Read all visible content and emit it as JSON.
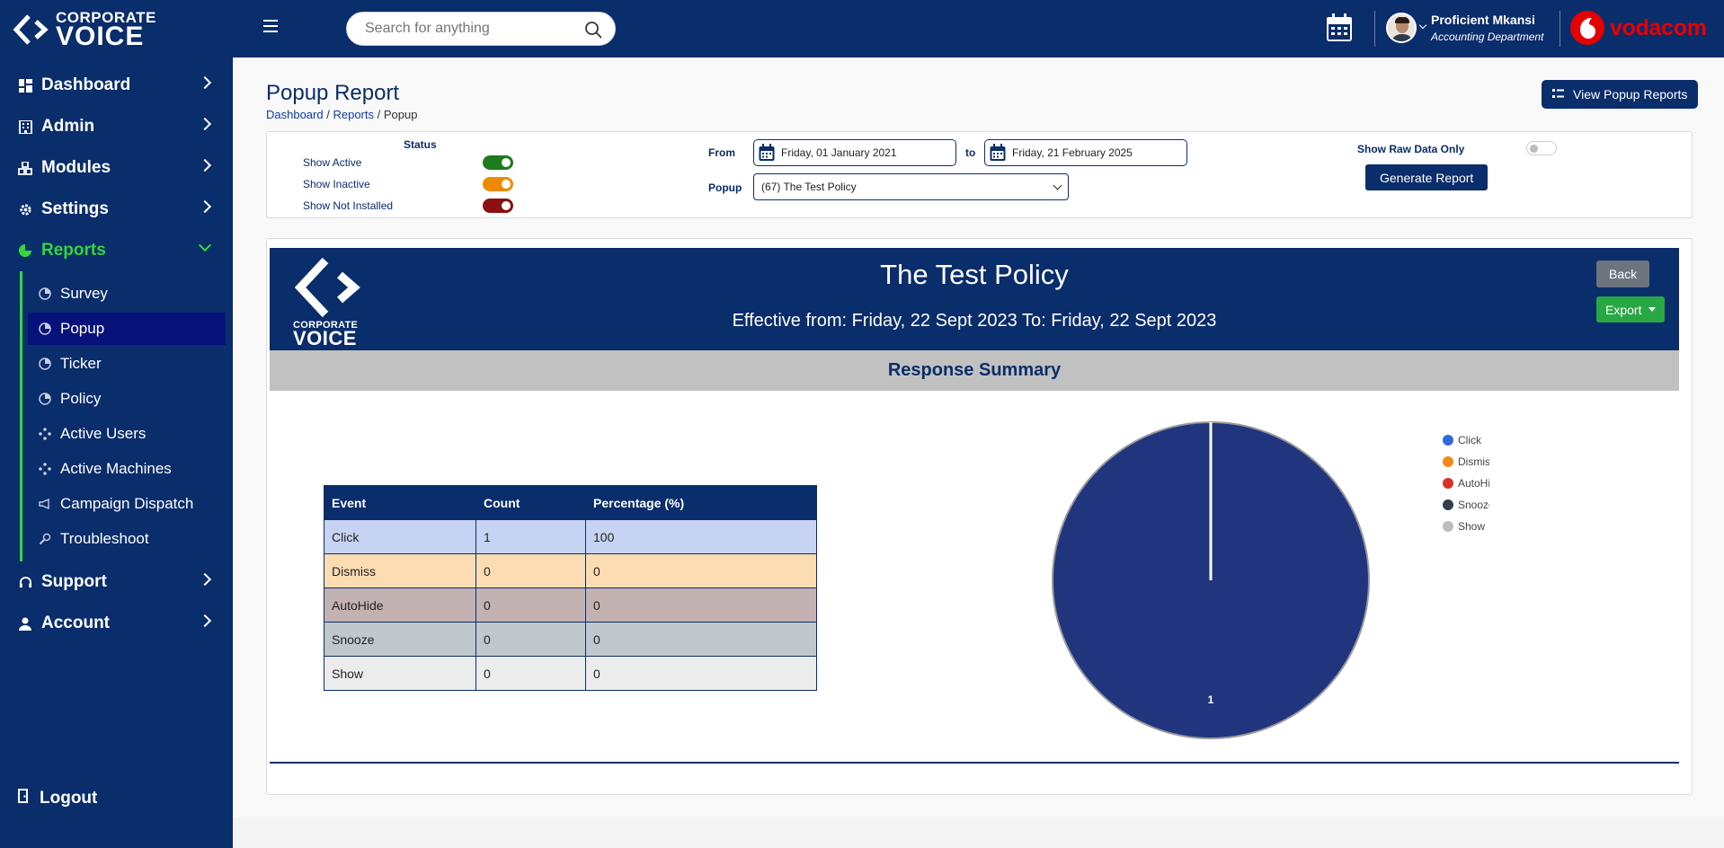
{
  "app": {
    "logo_line1": "CORPORATE",
    "logo_line2": "VOICE"
  },
  "sidebar": {
    "items": [
      {
        "label": "Dashboard",
        "icon": "grid-icon"
      },
      {
        "label": "Admin",
        "icon": "building-icon"
      },
      {
        "label": "Modules",
        "icon": "cubes-icon"
      },
      {
        "label": "Settings",
        "icon": "gear-icon"
      },
      {
        "label": "Reports",
        "icon": "pie-chart-icon"
      }
    ],
    "reports_sub": [
      {
        "label": "Survey",
        "icon": "pie-chart-icon"
      },
      {
        "label": "Popup",
        "icon": "pie-chart-icon"
      },
      {
        "label": "Ticker",
        "icon": "pie-chart-icon"
      },
      {
        "label": "Policy",
        "icon": "pie-chart-icon"
      },
      {
        "label": "Active Users",
        "icon": "network-icon"
      },
      {
        "label": "Active Machines",
        "icon": "network-icon"
      },
      {
        "label": "Campaign Dispatch",
        "icon": "megaphone-icon"
      },
      {
        "label": "Troubleshoot",
        "icon": "wrench-icon"
      }
    ],
    "lower_items": [
      {
        "label": "Support",
        "icon": "headset-icon"
      },
      {
        "label": "Account",
        "icon": "user-icon"
      }
    ],
    "logout": "Logout"
  },
  "topbar": {
    "search_placeholder": "Search for anything",
    "user_name": "Proficient Mkansi",
    "user_dept": "Accounting Department",
    "brand": "vodacom"
  },
  "page": {
    "title": "Popup Report",
    "breadcrumb": [
      "Dashboard",
      "Reports",
      "Popup"
    ],
    "view_button": "View Popup Reports"
  },
  "filters": {
    "status_title": "Status",
    "toggles": [
      {
        "label": "Show Active",
        "color": "#1d7a1d"
      },
      {
        "label": "Show Inactive",
        "color": "#ef8a00"
      },
      {
        "label": "Show Not Installed",
        "color": "#8b1010"
      }
    ],
    "from_label": "From",
    "from_value": "Friday, 01 January 2021",
    "to_label": "to",
    "to_value": "Friday, 21 February 2025",
    "popup_label": "Popup",
    "popup_value": "(67) The Test Policy",
    "raw_label": "Show Raw Data Only",
    "generate_button": "Generate Report"
  },
  "report": {
    "title": "The Test Policy",
    "subtitle": "Effective from: Friday, 22 Sept 2023 To: Friday, 22 Sept 2023",
    "back_button": "Back",
    "export_button": "Export",
    "summary_title": "Response Summary",
    "table": {
      "headers": [
        "Event",
        "Count",
        "Percentage (%)"
      ],
      "rows": [
        {
          "cells": [
            "Click",
            "1",
            "100"
          ],
          "bg": "#c7d3f3"
        },
        {
          "cells": [
            "Dismiss",
            "0",
            "0"
          ],
          "bg": "#fcdcb3"
        },
        {
          "cells": [
            "AutoHide",
            "0",
            "0"
          ],
          "bg": "#c4b2b2"
        },
        {
          "cells": [
            "Snooze",
            "0",
            "0"
          ],
          "bg": "#c0c8cc"
        },
        {
          "cells": [
            "Show",
            "0",
            "0"
          ],
          "bg": "#ececec"
        }
      ]
    }
  },
  "chart_data": {
    "type": "pie",
    "categories": [
      "Click",
      "Dismiss",
      "AutoHide",
      "Snooze",
      "Show"
    ],
    "values": [
      1,
      0,
      0,
      0,
      0
    ],
    "colors": [
      "#21357f",
      "#ef8a00",
      "#d9312a",
      "#343f4a",
      "#b9b9b9"
    ],
    "legend_colors": [
      "#2f6ad8",
      "#f28a1a",
      "#d9312a",
      "#343f4a",
      "#bdbdbd"
    ],
    "data_labels": [
      "1"
    ],
    "legend_position": "right"
  }
}
